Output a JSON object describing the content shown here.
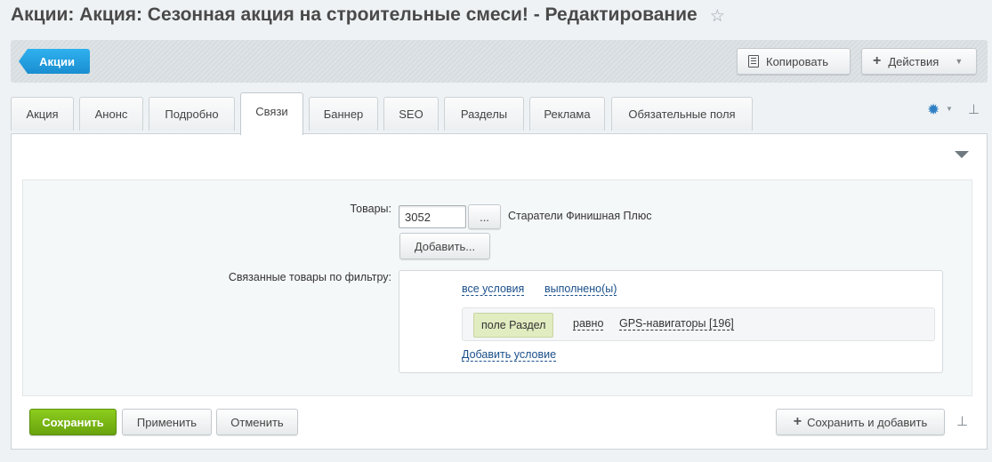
{
  "page": {
    "title": "Акции: Акция: Сезонная акция на строительные смеси! - Редактирование",
    "star_icon": "star-icon"
  },
  "toolbar": {
    "back_label": "Акции",
    "copy_label": "Копировать",
    "actions_label": "Действия"
  },
  "tabs": [
    {
      "label": "Акция"
    },
    {
      "label": "Анонс"
    },
    {
      "label": "Подробно"
    },
    {
      "label": "Связи",
      "active": true
    },
    {
      "label": "Баннер"
    },
    {
      "label": "SEO"
    },
    {
      "label": "Разделы"
    },
    {
      "label": "Реклама"
    },
    {
      "label": "Обязательные поля"
    }
  ],
  "form": {
    "products_label": "Товары:",
    "product_id": "3052",
    "browse_label": "...",
    "product_name": "Старатели Финишная Плюс",
    "add_label": "Добавить...",
    "filter_label": "Связанные товары по фильтру:",
    "filter": {
      "all_conditions": "все условия",
      "fulfilled": "выполнено(ы)",
      "field": "поле Раздел",
      "operator": "равно",
      "value": "GPS-навигаторы [196]",
      "add_condition": "Добавить условие"
    }
  },
  "footer": {
    "save_label": "Сохранить",
    "apply_label": "Применить",
    "cancel_label": "Отменить",
    "save_add_label": "Сохранить и добавить"
  },
  "colors": {
    "accent_blue": "#1a8ed0",
    "save_green": "#69a30d",
    "link_blue": "#1a4f8a"
  }
}
